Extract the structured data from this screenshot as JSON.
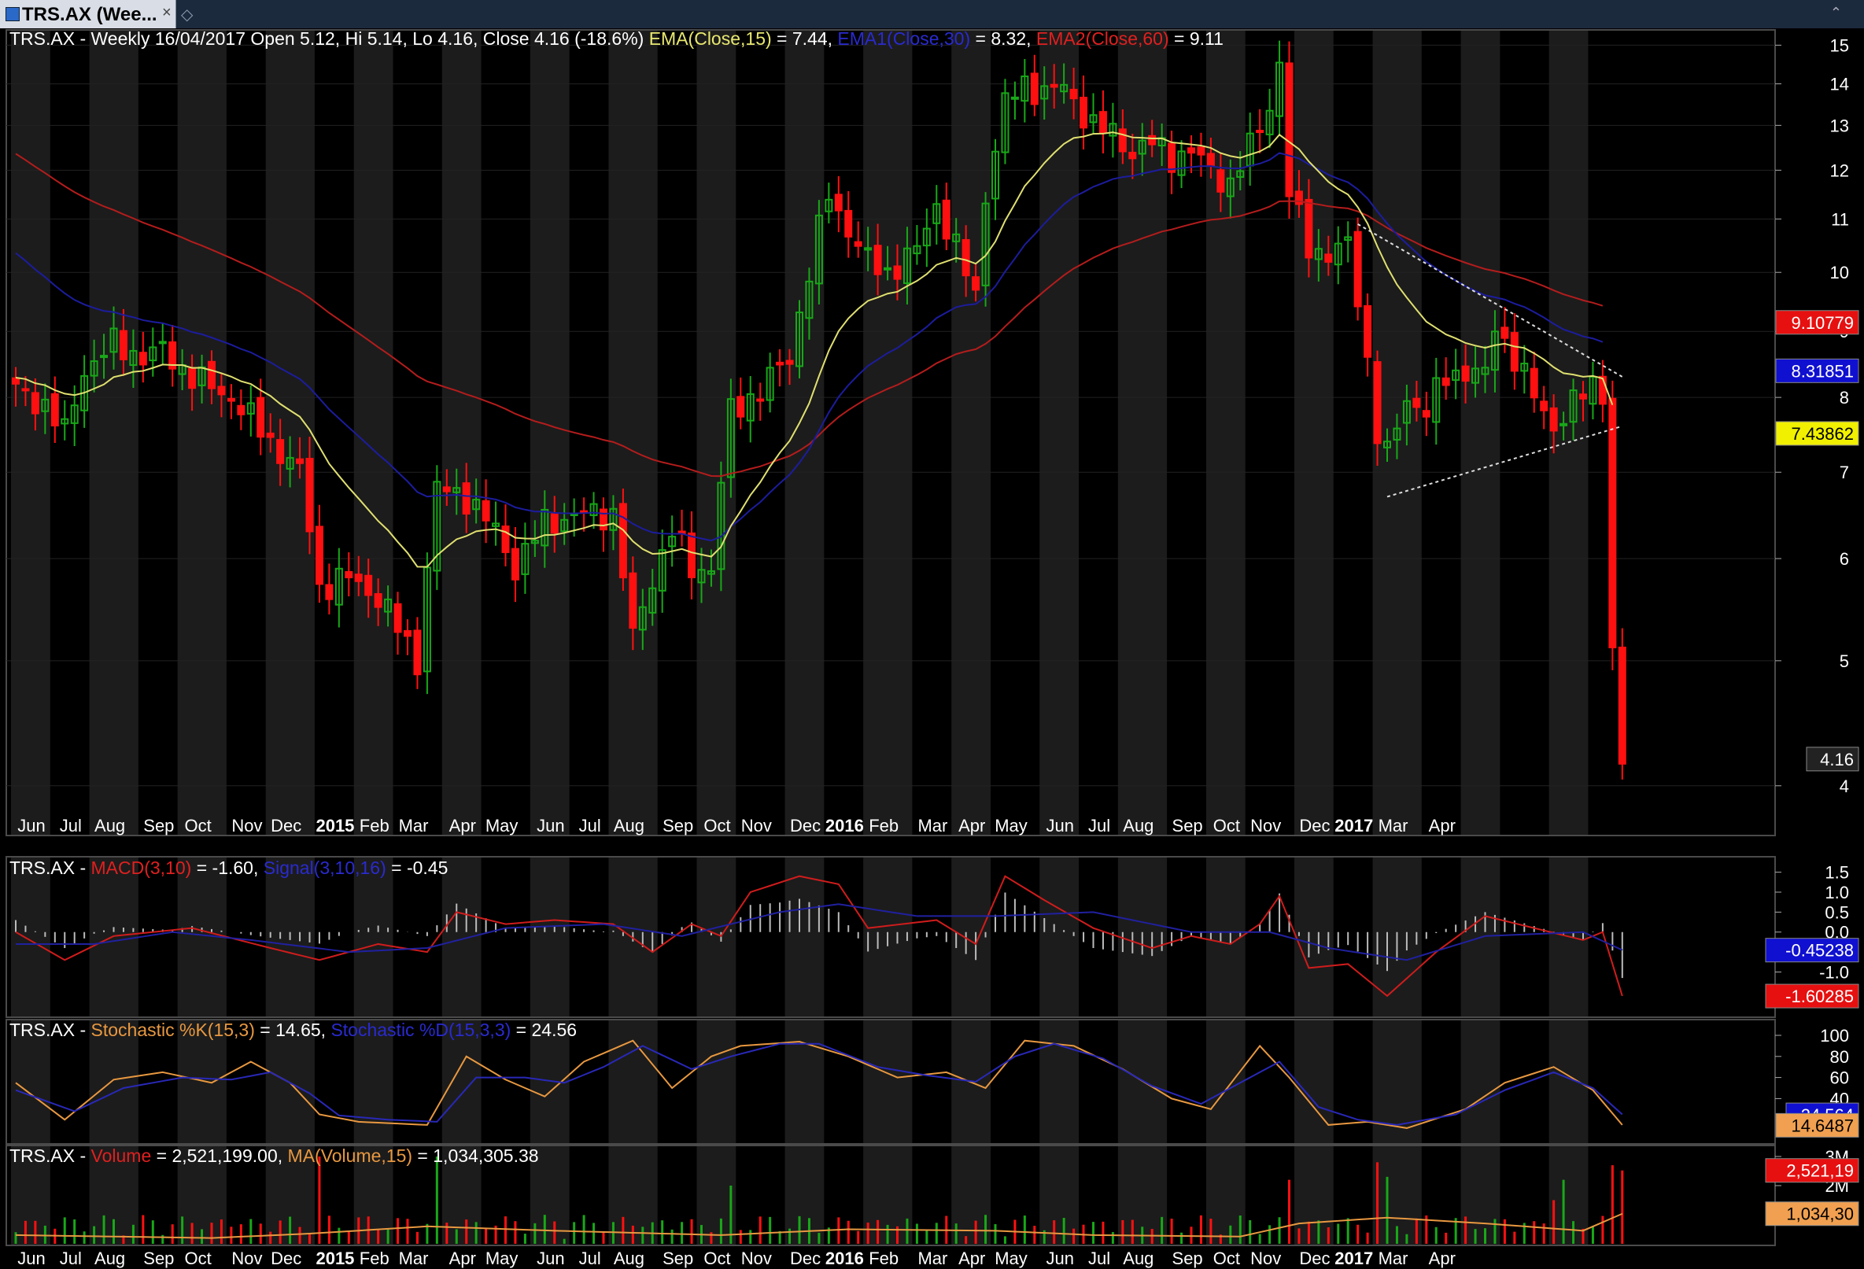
{
  "window": {
    "tab_title": "TRS.AX (Wee...",
    "tab_close": "×",
    "tab_pin": "◇",
    "collapse": "⌃"
  },
  "legends": {
    "price": {
      "prefix": "TRS.AX - Weekly 16/04/2017 Open 5.12, Hi 5.14, Lo 4.16, Close 4.16 (-18.6%) ",
      "ema": "EMA(Close,15)",
      "ema_val": " = 7.44, ",
      "ema1": "EMA1(Close,30)",
      "ema1_val": " = 8.32, ",
      "ema2": "EMA2(Close,60)",
      "ema2_val": " = 9.11"
    },
    "macd": {
      "prefix": "TRS.AX - ",
      "macd": "MACD(3,10)",
      "macd_val": " = -1.60, ",
      "signal": "Signal(3,10,16)",
      "signal_val": " = -0.45"
    },
    "stoch": {
      "prefix": "TRS.AX - ",
      "k": "Stochastic %K(15,3)",
      "k_val": " = 14.65, ",
      "d": "Stochastic %D(15,3,3)",
      "d_val": " = 24.56"
    },
    "volume": {
      "prefix": "TRS.AX - ",
      "vol": "Volume",
      "vol_val": " = 2,521,199.00, ",
      "ma": "MA(Volume,15)",
      "ma_val": " = 1,034,305.38"
    }
  },
  "colors": {
    "up": "#18a818",
    "down": "#ff1010",
    "ema": "#e0e070",
    "ema1": "#1c1c9e",
    "ema2": "#b41c1c",
    "stoch_k": "#e89840",
    "stoch_d": "#2828b8",
    "grid_band": "#1c1c1c",
    "axis_text": "#ffffff"
  },
  "chart_data": [
    {
      "type": "candlestick",
      "title": "TRS.AX - Weekly",
      "y_scale": "log",
      "ylim": [
        3.85,
        15.2
      ],
      "y_ticks": [
        "4",
        "5",
        "6",
        "7",
        "8",
        "9",
        "10",
        "11",
        "12",
        "13",
        "14",
        "15"
      ],
      "x_month_labels": [
        "Jun",
        "Jul",
        "Aug",
        "Sep",
        "Oct",
        "Nov",
        "Dec",
        "2015",
        "Feb",
        "Mar",
        "Apr",
        "May",
        "Jun",
        "Jul",
        "Aug",
        "Sep",
        "Oct",
        "Nov",
        "Dec",
        "2016",
        "Feb",
        "Mar",
        "Apr",
        "May",
        "Jun",
        "Jul",
        "Aug",
        "Sep",
        "Oct",
        "Nov",
        "Dec",
        "2017",
        "Mar",
        "Apr"
      ],
      "bold_labels": [
        "2015",
        "2016",
        "2017"
      ],
      "value_badges": [
        {
          "label": "9.10779",
          "value": 9.10779,
          "series": "ema2"
        },
        {
          "label": "8.31851",
          "value": 8.31851,
          "series": "ema1"
        },
        {
          "label": "7.43862",
          "value": 7.43862,
          "series": "ema"
        },
        {
          "label": "4.16",
          "value": 4.16,
          "series": "close"
        }
      ],
      "anchors": [
        [
          0,
          8.1
        ],
        [
          3,
          7.9
        ],
        [
          5,
          7.5
        ],
        [
          7,
          8.4
        ],
        [
          10,
          8.8
        ],
        [
          13,
          8.6
        ],
        [
          15,
          8.7
        ],
        [
          18,
          8.3
        ],
        [
          22,
          8.0
        ],
        [
          26,
          7.4
        ],
        [
          29,
          7.0
        ],
        [
          31,
          5.7
        ],
        [
          34,
          5.8
        ],
        [
          37,
          5.6
        ],
        [
          41,
          5.0
        ],
        [
          43,
          6.8
        ],
        [
          46,
          6.7
        ],
        [
          49,
          6.3
        ],
        [
          51,
          5.9
        ],
        [
          54,
          6.4
        ],
        [
          58,
          6.5
        ],
        [
          61,
          6.5
        ],
        [
          63,
          5.2
        ],
        [
          65,
          5.8
        ],
        [
          67,
          6.3
        ],
        [
          69,
          5.9
        ],
        [
          71,
          5.9
        ],
        [
          73,
          7.8
        ],
        [
          76,
          8.1
        ],
        [
          79,
          8.6
        ],
        [
          81,
          10.0
        ],
        [
          83,
          11.5
        ],
        [
          85,
          10.8
        ],
        [
          87,
          10.2
        ],
        [
          89,
          10.0
        ],
        [
          92,
          10.4
        ],
        [
          94,
          11.3
        ],
        [
          97,
          10.0
        ],
        [
          98,
          9.6
        ],
        [
          99,
          11.5
        ],
        [
          101,
          13.5
        ],
        [
          103,
          14.0
        ],
        [
          105,
          13.8
        ],
        [
          107,
          13.9
        ],
        [
          110,
          13.0
        ],
        [
          112,
          12.8
        ],
        [
          114,
          12.4
        ],
        [
          116,
          12.6
        ],
        [
          118,
          12.3
        ],
        [
          120,
          12.4
        ],
        [
          122,
          12.0
        ],
        [
          124,
          11.7
        ],
        [
          126,
          12.5
        ],
        [
          128,
          13.5
        ],
        [
          129,
          14.5
        ],
        [
          130,
          11.5
        ],
        [
          132,
          10.5
        ],
        [
          134,
          10.3
        ],
        [
          136,
          10.5
        ],
        [
          137,
          9.6
        ],
        [
          139,
          7.5
        ],
        [
          140,
          7.2
        ],
        [
          142,
          8.0
        ],
        [
          144,
          7.8
        ],
        [
          146,
          8.3
        ],
        [
          148,
          8.4
        ],
        [
          150,
          8.3
        ],
        [
          151,
          9.1
        ],
        [
          153,
          8.6
        ],
        [
          155,
          8.0
        ],
        [
          157,
          7.6
        ],
        [
          159,
          7.9
        ],
        [
          161,
          8.2
        ],
        [
          162,
          8.1
        ],
        [
          163,
          5.12
        ],
        [
          164,
          4.16
        ]
      ],
      "ema15_last": 7.44,
      "ema30_last": 8.32,
      "ema60_last": 9.11
    },
    {
      "type": "line",
      "title": "MACD(3,10) / Signal(3,10,16)",
      "ylim": [
        -1.7,
        1.65
      ],
      "y_ticks": [
        "1.5",
        "1.0",
        "0.5",
        "0.0",
        "-0.5",
        "-1.0"
      ],
      "value_badges": [
        {
          "label": "-0.45238",
          "value": -0.45238,
          "series": "signal"
        },
        {
          "label": "-1.60285",
          "value": -1.60285,
          "series": "macd"
        }
      ],
      "series": [
        {
          "name": "MACD(3,10)",
          "points": [
            [
              0,
              0
            ],
            [
              5,
              -0.7
            ],
            [
              10,
              -0.1
            ],
            [
              18,
              0.1
            ],
            [
              26,
              -0.4
            ],
            [
              31,
              -0.7
            ],
            [
              37,
              -0.3
            ],
            [
              42,
              -0.5
            ],
            [
              45,
              0.5
            ],
            [
              50,
              0.2
            ],
            [
              55,
              0.3
            ],
            [
              61,
              0.2
            ],
            [
              65,
              -0.5
            ],
            [
              69,
              0.2
            ],
            [
              72,
              -0.1
            ],
            [
              75,
              1.0
            ],
            [
              80,
              1.4
            ],
            [
              84,
              1.2
            ],
            [
              87,
              0.1
            ],
            [
              94,
              0.3
            ],
            [
              98,
              -0.3
            ],
            [
              101,
              1.4
            ],
            [
              105,
              0.8
            ],
            [
              110,
              0.1
            ],
            [
              116,
              -0.4
            ],
            [
              120,
              -0.1
            ],
            [
              124,
              -0.3
            ],
            [
              127,
              0.2
            ],
            [
              129,
              0.9
            ],
            [
              132,
              -0.9
            ],
            [
              136,
              -0.8
            ],
            [
              140,
              -1.6
            ],
            [
              145,
              -0.5
            ],
            [
              150,
              0.4
            ],
            [
              155,
              0.1
            ],
            [
              160,
              -0.2
            ],
            [
              162,
              0.0
            ],
            [
              164,
              -1.6
            ]
          ]
        },
        {
          "name": "Signal(3,10,16)",
          "points": [
            [
              0,
              -0.3
            ],
            [
              8,
              -0.3
            ],
            [
              16,
              0.0
            ],
            [
              24,
              -0.2
            ],
            [
              34,
              -0.5
            ],
            [
              42,
              -0.4
            ],
            [
              50,
              0.1
            ],
            [
              60,
              0.2
            ],
            [
              68,
              -0.1
            ],
            [
              78,
              0.5
            ],
            [
              84,
              0.7
            ],
            [
              92,
              0.4
            ],
            [
              100,
              0.4
            ],
            [
              110,
              0.5
            ],
            [
              120,
              0.0
            ],
            [
              128,
              0.0
            ],
            [
              134,
              -0.4
            ],
            [
              142,
              -0.7
            ],
            [
              150,
              -0.1
            ],
            [
              160,
              0.0
            ],
            [
              164,
              -0.45
            ]
          ]
        }
      ]
    },
    {
      "type": "line",
      "title": "Stochastic %K(15,3) / %D(15,3,3)",
      "ylim": [
        0,
        100
      ],
      "y_ticks": [
        "100",
        "80",
        "60",
        "40"
      ],
      "value_badges": [
        {
          "label": "24.564",
          "value": 24.564,
          "series": "d"
        },
        {
          "label": "14.6487",
          "value": 14.6487,
          "series": "k"
        }
      ],
      "series": [
        {
          "name": "Stochastic %K(15,3)",
          "points": [
            [
              0,
              55
            ],
            [
              5,
              20
            ],
            [
              10,
              58
            ],
            [
              15,
              65
            ],
            [
              20,
              55
            ],
            [
              24,
              75
            ],
            [
              28,
              55
            ],
            [
              31,
              25
            ],
            [
              35,
              18
            ],
            [
              42,
              15
            ],
            [
              46,
              80
            ],
            [
              50,
              58
            ],
            [
              54,
              42
            ],
            [
              58,
              75
            ],
            [
              63,
              95
            ],
            [
              67,
              50
            ],
            [
              71,
              80
            ],
            [
              74,
              90
            ],
            [
              80,
              94
            ],
            [
              85,
              80
            ],
            [
              90,
              60
            ],
            [
              95,
              65
            ],
            [
              99,
              50
            ],
            [
              103,
              95
            ],
            [
              108,
              90
            ],
            [
              113,
              68
            ],
            [
              118,
              40
            ],
            [
              122,
              30
            ],
            [
              127,
              90
            ],
            [
              130,
              60
            ],
            [
              134,
              15
            ],
            [
              138,
              18
            ],
            [
              142,
              12
            ],
            [
              148,
              30
            ],
            [
              152,
              55
            ],
            [
              157,
              70
            ],
            [
              161,
              48
            ],
            [
              164,
              15
            ]
          ]
        },
        {
          "name": "Stochastic %D(15,3,3)",
          "points": [
            [
              0,
              48
            ],
            [
              6,
              28
            ],
            [
              11,
              50
            ],
            [
              17,
              60
            ],
            [
              22,
              58
            ],
            [
              26,
              65
            ],
            [
              30,
              45
            ],
            [
              33,
              24
            ],
            [
              38,
              20
            ],
            [
              43,
              18
            ],
            [
              47,
              60
            ],
            [
              52,
              60
            ],
            [
              56,
              55
            ],
            [
              60,
              70
            ],
            [
              64,
              90
            ],
            [
              69,
              68
            ],
            [
              73,
              80
            ],
            [
              78,
              92
            ],
            [
              82,
              92
            ],
            [
              88,
              70
            ],
            [
              93,
              62
            ],
            [
              98,
              56
            ],
            [
              102,
              80
            ],
            [
              106,
              92
            ],
            [
              111,
              78
            ],
            [
              116,
              52
            ],
            [
              121,
              35
            ],
            [
              125,
              55
            ],
            [
              129,
              75
            ],
            [
              133,
              32
            ],
            [
              137,
              20
            ],
            [
              141,
              15
            ],
            [
              147,
              25
            ],
            [
              152,
              48
            ],
            [
              157,
              65
            ],
            [
              161,
              50
            ],
            [
              164,
              25
            ]
          ]
        }
      ]
    },
    {
      "type": "bar",
      "title": "Volume / MA(Volume,15)",
      "ylim": [
        0,
        3000000
      ],
      "y_ticks": [
        "3M",
        "2M"
      ],
      "value_badges": [
        {
          "label": "2,521,19",
          "value": 2521199,
          "series": "volume"
        },
        {
          "label": "1,034,30",
          "value": 1034305,
          "series": "ma"
        }
      ],
      "volume_last": 2521199,
      "ma_last": 1034305,
      "volume_spikes": [
        {
          "week": 31,
          "value": 3000000
        },
        {
          "week": 43,
          "value": 3000000
        },
        {
          "week": 73,
          "value": 2000000
        },
        {
          "week": 130,
          "value": 2200000
        },
        {
          "week": 139,
          "value": 2800000
        },
        {
          "week": 140,
          "value": 2300000
        },
        {
          "week": 157,
          "value": 1500000
        },
        {
          "week": 158,
          "value": 2200000
        },
        {
          "week": 163,
          "value": 2700000
        },
        {
          "week": 164,
          "value": 2521199
        }
      ],
      "ma_points": [
        [
          0,
          300000
        ],
        [
          20,
          200000
        ],
        [
          30,
          350000
        ],
        [
          42,
          600000
        ],
        [
          55,
          450000
        ],
        [
          72,
          300000
        ],
        [
          85,
          500000
        ],
        [
          100,
          450000
        ],
        [
          110,
          300000
        ],
        [
          125,
          250000
        ],
        [
          131,
          700000
        ],
        [
          140,
          900000
        ],
        [
          150,
          700000
        ],
        [
          160,
          450000
        ],
        [
          164,
          1034305
        ]
      ]
    }
  ]
}
